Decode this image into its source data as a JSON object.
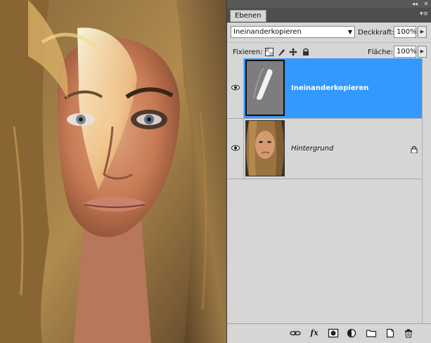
{
  "panel": {
    "tab_label": "Ebenen",
    "topbar": {
      "collapse_icon": "double-chevron-left-icon",
      "close_icon": "close-icon",
      "menu_icon": "panel-menu-icon"
    }
  },
  "blend": {
    "mode": "Ineinanderkopieren",
    "opacity_label": "Deckkraft:",
    "opacity_value": "100%"
  },
  "locks": {
    "label": "Fixieren:",
    "fill_label": "Fläche:",
    "fill_value": "100%",
    "icons": [
      "lock-transparent-pixels-icon",
      "lock-image-pixels-icon",
      "lock-position-icon",
      "lock-all-icon"
    ]
  },
  "layers": [
    {
      "name": "Ineinanderkopieren",
      "selected": true,
      "visible": true,
      "locked": false
    },
    {
      "name": "Hintergrund",
      "selected": false,
      "visible": true,
      "locked": true
    }
  ],
  "footer": {
    "icons": [
      "link-layers-icon",
      "layer-style-fx-icon",
      "layer-mask-icon",
      "adjustment-layer-icon",
      "new-group-icon",
      "new-layer-icon",
      "delete-layer-icon"
    ],
    "fx_label": "fx"
  },
  "colors": {
    "selection": "#3399ff",
    "panel_bg": "#d6d6d6"
  }
}
